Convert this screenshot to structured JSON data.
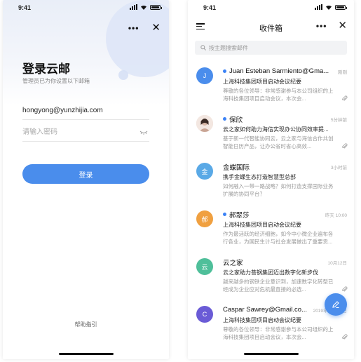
{
  "login": {
    "status_time": "9:41",
    "title": "登录云邮",
    "subtitle": "管理员已为你设置以下邮箱",
    "email_value": "hongyong@yunzhijia.com",
    "password_placeholder": "请输入密码",
    "login_button": "登录",
    "help_link": "帮助指引",
    "dots_label": "•••",
    "close_label": "✕"
  },
  "inbox": {
    "status_time": "9:41",
    "title": "收件箱",
    "dots_label": "•••",
    "close_label": "✕",
    "search_placeholder": "按主题搜索邮件",
    "mails": [
      {
        "avatar": "J",
        "color": "#4a8dec",
        "unread": true,
        "sender": "Juan Esteban Sarmiento@Gma...",
        "time": "刚刚",
        "subject": "上海科技集团项目启动会议纪要",
        "preview": "尊敬的各位领导：非常感谢参与本公司组织的上海科技集团项目启动会议，本次会...",
        "attachment": true
      },
      {
        "avatar": "",
        "color": "#e9d5c9",
        "unread": true,
        "sender": "保欣",
        "time": "5分钟前",
        "subject": "云之家如何助力海信实现办公协同效率提...",
        "preview": "基于新一代智能协同云，云之家与海信合作共创智能日历产品，让办公省时省心高效...",
        "attachment": true
      },
      {
        "avatar": "金",
        "color": "#5aa9e6",
        "unread": false,
        "sender": "金蝶国际",
        "time": "3小时前",
        "subject": "携手金蝶生态打造智慧型总部",
        "preview": "如何融入一带一路战略？如何打造支撑国际业务扩展的协同平台？",
        "attachment": false
      },
      {
        "avatar": "郝",
        "color": "#f0a040",
        "unread": true,
        "sender": "郝翠莎",
        "time": "昨天 10:00",
        "subject": "上海科技集团项目启动会议纪要",
        "preview": "作为最活跃的经济细胞，如今中小微企业遍布各行各业，为国民生计与社会发展做出了重要贡...",
        "attachment": false
      },
      {
        "avatar": "云",
        "color": "#4fbf9a",
        "unread": false,
        "sender": "云之家",
        "time": "10月12日",
        "subject": "云之家助力菩钢集团迈出数字化新步伐",
        "preview": "越来越多的钢铁企业意识到，加速数字化转型已经成为企业应对危机最直接的必选...",
        "attachment": true
      },
      {
        "avatar": "C",
        "color": "#6a5bd6",
        "unread": false,
        "sender": "Caspar Sawrey@Gmail.co...",
        "time": "2019年10月12日",
        "subject": "上海科技集团项目启动会议纪要",
        "preview": "尊敬的各位领导：非常感谢参与本公司组织的上海科技集团项目启动会议，本次会...",
        "attachment": true
      }
    ]
  }
}
